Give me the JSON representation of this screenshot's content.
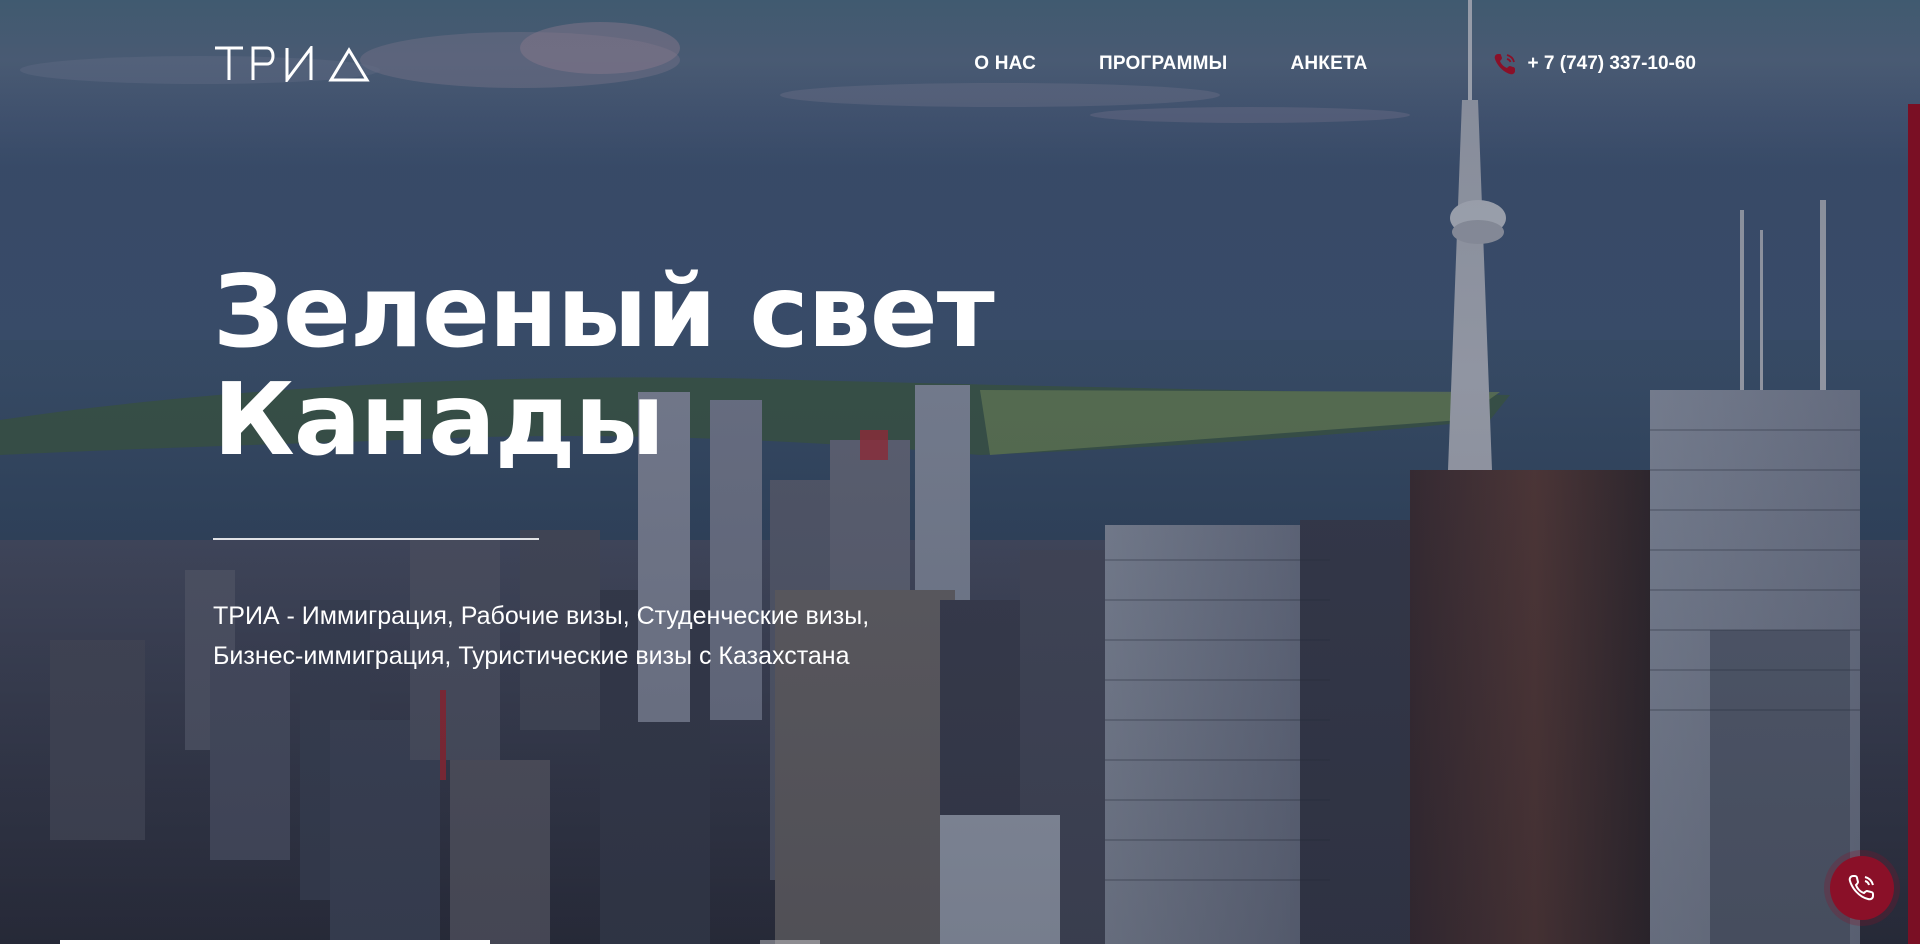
{
  "header": {
    "logo_text": "ТРИ Д",
    "nav": [
      {
        "label": "О НАС"
      },
      {
        "label": "ПРОГРАММЫ"
      },
      {
        "label": "АНКЕТА"
      }
    ],
    "phone": "+ 7 (747) 337-10-60"
  },
  "hero": {
    "title_line1": "Зеленый свет",
    "title_line2": "Канады",
    "subtitle_line1": "ТРИА - Иммиграция, Рабочие визы, Студенческие визы,",
    "subtitle_line2": "Бизнес-иммиграция, Туристические визы с Казахстана"
  },
  "colors": {
    "accent": "#8a1028",
    "text": "#ffffff"
  },
  "icons": {
    "phone": "phone-icon",
    "call_fab": "phone-call-icon"
  }
}
